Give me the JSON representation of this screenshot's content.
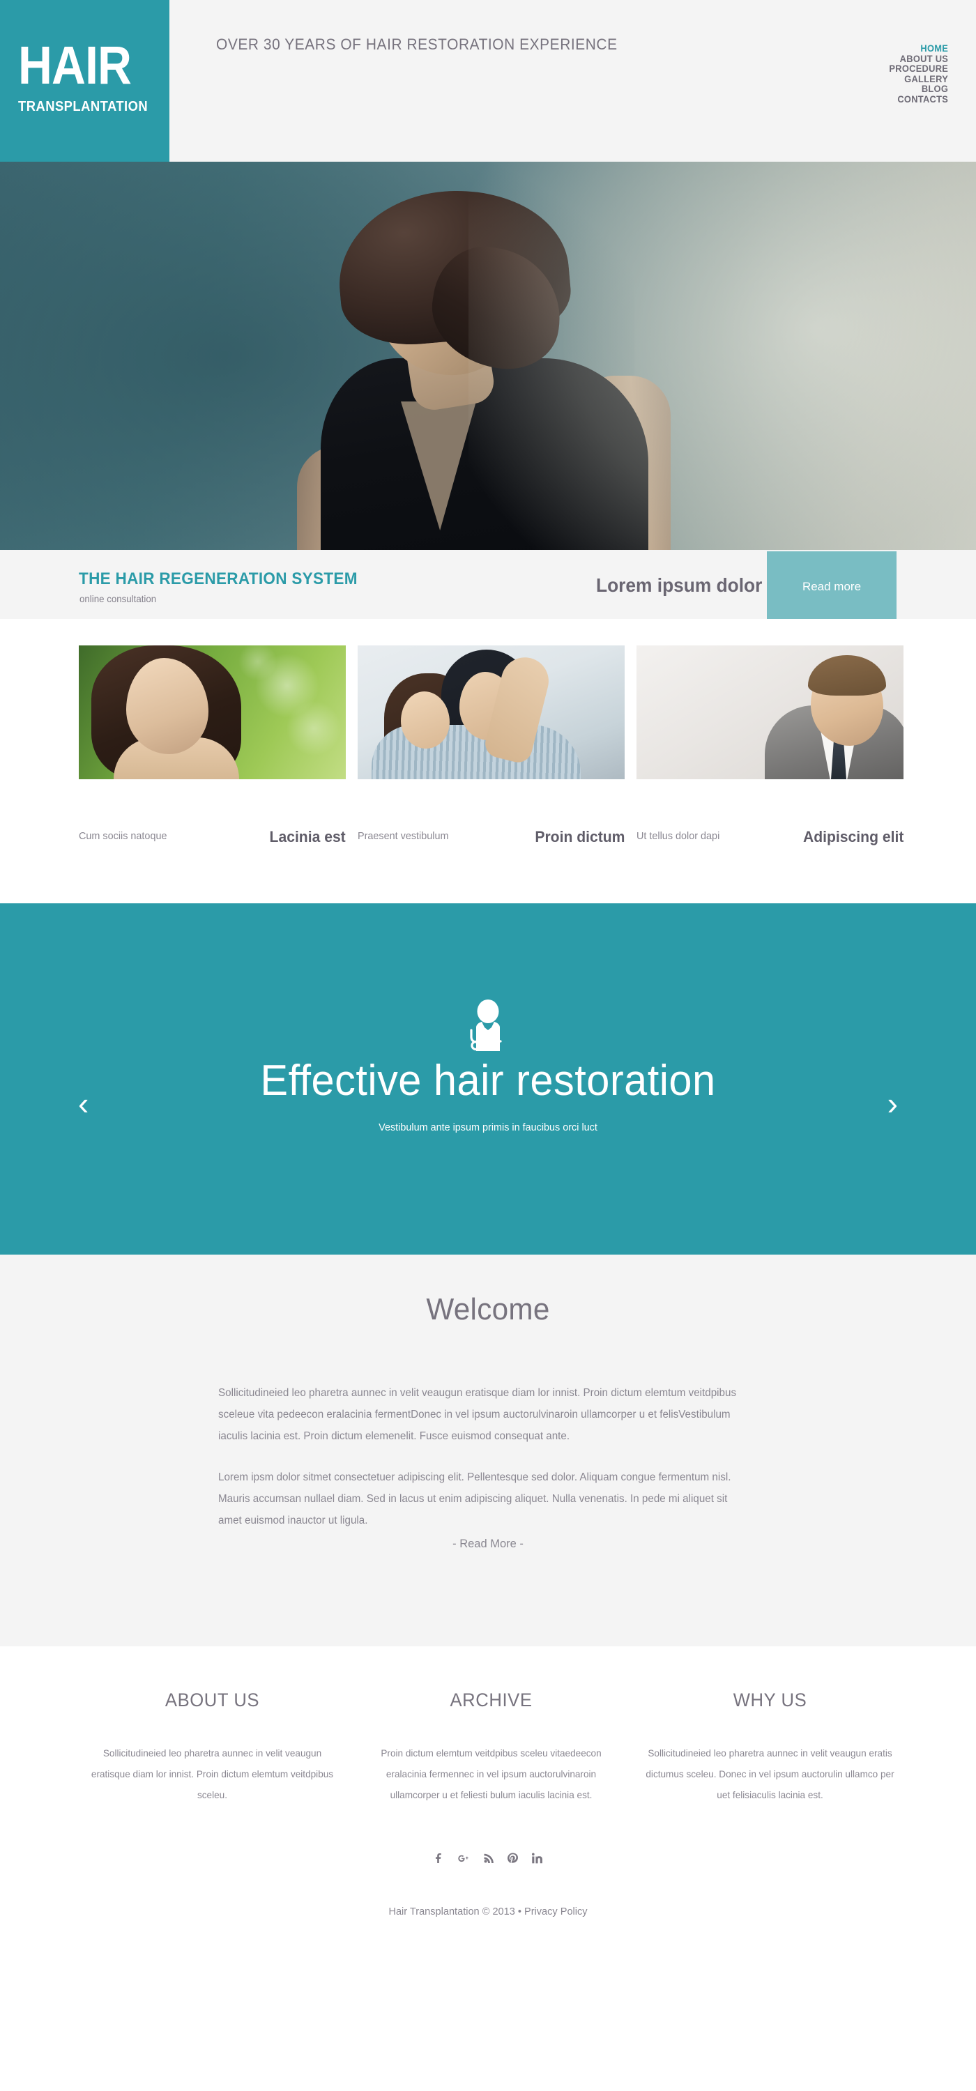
{
  "colors": {
    "brand_teal": "#2b9ba8",
    "brand_teal_light": "#79bdc3",
    "grey_bg": "#f4f4f4",
    "text_grey": "#8a8791",
    "heading_grey": "#77737e"
  },
  "header": {
    "logo_main": "HAIR",
    "logo_sub": "TRANSPLANTATION",
    "tagline": "OVER 30 YEARS OF HAIR RESTORATION EXPERIENCE",
    "nav": [
      {
        "label": "HOME",
        "active": true
      },
      {
        "label": "ABOUT US",
        "active": false
      },
      {
        "label": "PROCEDURE",
        "active": false
      },
      {
        "label": "GALLERY",
        "active": false
      },
      {
        "label": "BLOG",
        "active": false
      },
      {
        "label": "CONTACTS",
        "active": false
      }
    ]
  },
  "hero": {
    "alt": "man-with-dark-hair-photo"
  },
  "banner": {
    "title": "THE HAIR REGENERATION SYSTEM",
    "subtitle": "online consultation",
    "lorem": "Lorem ipsum dolor",
    "button_label": "Read more"
  },
  "gallery": {
    "items": [
      {
        "image_alt": "woman-on-green-background-photo",
        "caption_left": "Cum sociis natoque",
        "caption_right": "Lacinia est"
      },
      {
        "image_alt": "happy-couple-embracing-photo",
        "caption_left": "Praesent vestibulum",
        "caption_right": "Proin dictum"
      },
      {
        "image_alt": "businessman-in-suit-photo",
        "caption_left": "Ut tellus dolor dapi",
        "caption_right": "Adipiscing elit"
      }
    ]
  },
  "slider": {
    "icon": "doctor-stethoscope-icon",
    "title": "Effective hair restoration",
    "subtitle": "Vestibulum ante ipsum primis in faucibus orci luct",
    "prev_label": "‹",
    "next_label": "›"
  },
  "welcome": {
    "title": "Welcome",
    "paragraphs": [
      "Sollicitudineied leo pharetra aunnec in velit veaugun eratisque diam lor innist. Proin dictum elemtum veitdpibus sceleue vita pedeecon eralacinia fermentDonec in vel ipsum auctorulvinaroin ullamcorper u et felisVestibulum iaculis lacinia est. Proin dictum elemenelit. Fusce euismod consequat ante.",
      "Lorem ipsm dolor sitmet consectetuer adipiscing elit. Pellentesque sed dolor. Aliquam congue fermentum nisl. Mauris accumsan nullael diam. Sed in lacus ut enim adipiscing aliquet. Nulla venenatis. In pede mi aliquet sit amet euismod inauctor ut ligula."
    ],
    "read_more": "- Read More -"
  },
  "footer": {
    "columns": [
      {
        "heading": "ABOUT US",
        "text": "Sollicitudineied leo pharetra aunnec in velit veaugun eratisque diam lor innist. Proin dictum elemtum veitdpibus sceleu."
      },
      {
        "heading": "ARCHIVE",
        "text": "Proin dictum elemtum veitdpibus sceleu vitaedeecon eralacinia fermennec in vel ipsum auctorulvinaroin ullamcorper u et feliesti bulum iaculis lacinia est."
      },
      {
        "heading": "WHY US",
        "text": "Sollicitudineied leo pharetra aunnec in velit veaugun eratis dictumus sceleu. Donec in vel ipsum auctorulin ullamco per uet felisiaculis lacinia est."
      }
    ],
    "social": [
      "facebook-icon",
      "google-plus-icon",
      "rss-icon",
      "pinterest-icon",
      "linkedin-icon"
    ],
    "copyright": "Hair Transplantation © 2013 • Privacy Policy"
  }
}
